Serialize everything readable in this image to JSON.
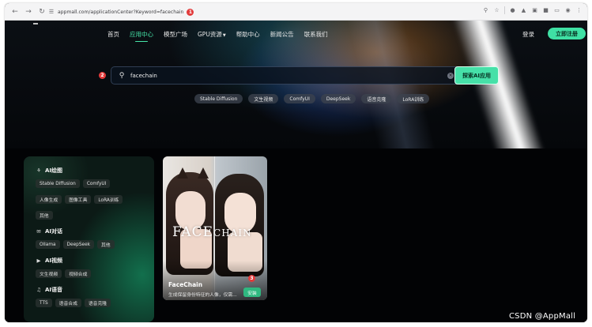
{
  "browser": {
    "url": "appmall.com/applicationCenter?Keyword=facechain",
    "step_badge": "1"
  },
  "site": {
    "nav": [
      "首页",
      "应用中心",
      "模型广场",
      "GPU资源",
      "帮助中心",
      "新闻公告",
      "联系我们"
    ],
    "nav_active_index": 1,
    "login": "登录",
    "register": "立即注册"
  },
  "search": {
    "step_badge": "2",
    "value": "facechain",
    "button": "探索AI应用",
    "tags": [
      "Stable Diffusion",
      "文生视频",
      "ComfyUI",
      "DeepSeek",
      "语音克隆",
      "LoRA训练"
    ]
  },
  "sidebar": {
    "categories": [
      {
        "title": "AI绘图",
        "icon": "palette-icon",
        "rows": [
          [
            "Stable Diffusion",
            "ComfyUI"
          ],
          [
            "人像生成",
            "图像工具",
            "LoRA训练"
          ],
          [
            "其他"
          ]
        ]
      },
      {
        "title": "AI对话",
        "icon": "chat-icon",
        "rows": [
          [
            "Ollama",
            "DeepSeek",
            "其他"
          ]
        ]
      },
      {
        "title": "AI视频",
        "icon": "video-icon",
        "rows": [
          [
            "文生视频",
            "视频合成"
          ]
        ]
      },
      {
        "title": "AI语音",
        "icon": "voice-icon",
        "rows": [
          [
            "TTS",
            "语音合成",
            "语音克隆"
          ]
        ]
      }
    ]
  },
  "card": {
    "overlay_text_main": "FACE",
    "overlay_text_small": "CHAIN",
    "title": "FaceChain",
    "description": "生成保留身份特征的人像，仅需...",
    "step_badge": "3",
    "install": "安装"
  },
  "watermark": "CSDN @AppMall",
  "colors": {
    "accent": "#46e0a8",
    "badge": "#e23b3b"
  }
}
